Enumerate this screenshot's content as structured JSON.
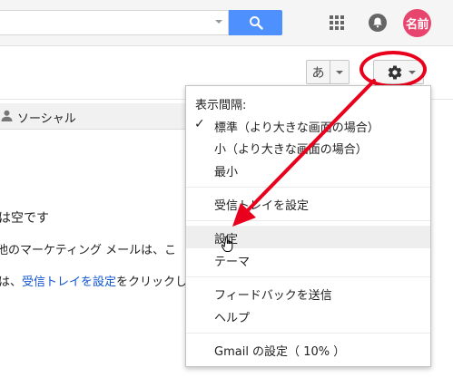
{
  "header": {
    "avatar_text": "名前",
    "icons": [
      "search-icon",
      "apps-grid-icon",
      "notifications-bell-icon"
    ]
  },
  "toolbar": {
    "ime_label": "あ",
    "icons": [
      "settings-gear-icon",
      "chevron-down-icon"
    ]
  },
  "tabs": {
    "social_label": "ソーシャル"
  },
  "content": {
    "empty_message": "は空です",
    "promo_text": "他のマーケティング メールは、こ",
    "help_prefix": "は、",
    "help_link": "受信トレイを設定",
    "help_suffix": "をクリックし"
  },
  "menu": {
    "header": "表示間隔:",
    "density": [
      {
        "label": "標準（より大きな画面の場合）",
        "checked": true
      },
      {
        "label": "小（より大きな画面の場合）",
        "checked": false
      },
      {
        "label": "最小",
        "checked": false
      }
    ],
    "configure_inbox": "受信トレイを設定",
    "settings": "設定",
    "themes": "テーマ",
    "feedback": "フィードバックを送信",
    "help": "ヘルプ",
    "gmail_settings": "Gmail の設定（ 10% ）",
    "check_glyph": "✓"
  },
  "annotation": {
    "color": "#e8001c"
  },
  "colors": {
    "search_button": "#4d90fe",
    "avatar": "#e8456e",
    "link": "#1155cc"
  }
}
